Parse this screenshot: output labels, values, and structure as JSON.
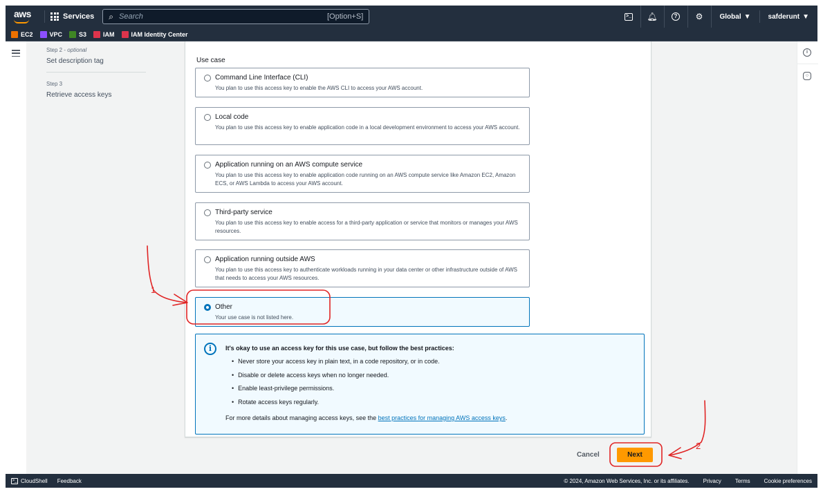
{
  "topnav": {
    "logo": "aws",
    "services_label": "Services",
    "search_placeholder": "Search",
    "search_shortcut": "[Option+S]",
    "region": "Global",
    "account": "safderunt",
    "icons": [
      "cloudshell-icon",
      "bell-icon",
      "help-icon",
      "settings-icon"
    ]
  },
  "favorites": [
    {
      "label": "EC2",
      "color": "#ed7100"
    },
    {
      "label": "VPC",
      "color": "#8c4fff"
    },
    {
      "label": "S3",
      "color": "#3f8624"
    },
    {
      "label": "IAM",
      "color": "#dd344c"
    },
    {
      "label": "IAM Identity Center",
      "color": "#dd344c"
    }
  ],
  "steps": [
    {
      "label": "Step 2",
      "optional": "optional",
      "title": "Set description tag"
    },
    {
      "label": "Step 3",
      "title": "Retrieve access keys"
    }
  ],
  "form": {
    "section_label": "Use case",
    "options": [
      {
        "title": "Command Line Interface (CLI)",
        "desc": "You plan to use this access key to enable the AWS CLI to access your AWS account.",
        "selected": false
      },
      {
        "title": "Local code",
        "desc": "You plan to use this access key to enable application code in a local development environment to access your AWS account.",
        "selected": false
      },
      {
        "title": "Application running on an AWS compute service",
        "desc": "You plan to use this access key to enable application code running on an AWS compute service like Amazon EC2, Amazon ECS, or AWS Lambda to access your AWS account.",
        "selected": false
      },
      {
        "title": "Third-party service",
        "desc": "You plan to use this access key to enable access for a third-party application or service that monitors or manages your AWS resources.",
        "selected": false
      },
      {
        "title": "Application running outside AWS",
        "desc": "You plan to use this access key to authenticate workloads running in your data center or other infrastructure outside of AWS that needs to access your AWS resources.",
        "selected": false
      },
      {
        "title": "Other",
        "desc": "Your use case is not listed here.",
        "selected": true
      }
    ],
    "alert": {
      "title": "It's okay to use an access key for this use case, but follow the best practices:",
      "items": [
        "Never store your access key in plain text, in a code repository, or in code.",
        "Disable or delete access keys when no longer needed.",
        "Enable least-privilege permissions.",
        "Rotate access keys regularly."
      ],
      "footer_text": "For more details about managing access keys, see the ",
      "footer_link": "best practices for managing AWS access keys",
      "footer_end": "."
    }
  },
  "actions": {
    "cancel": "Cancel",
    "next": "Next"
  },
  "annotations": {
    "step1": "1",
    "step2": "2",
    "color": "#e02424"
  },
  "footer": {
    "cloudshell": "CloudShell",
    "feedback": "Feedback",
    "copyright": "© 2024, Amazon Web Services, Inc. or its affiliates.",
    "privacy": "Privacy",
    "terms": "Terms",
    "cookies": "Cookie preferences"
  }
}
